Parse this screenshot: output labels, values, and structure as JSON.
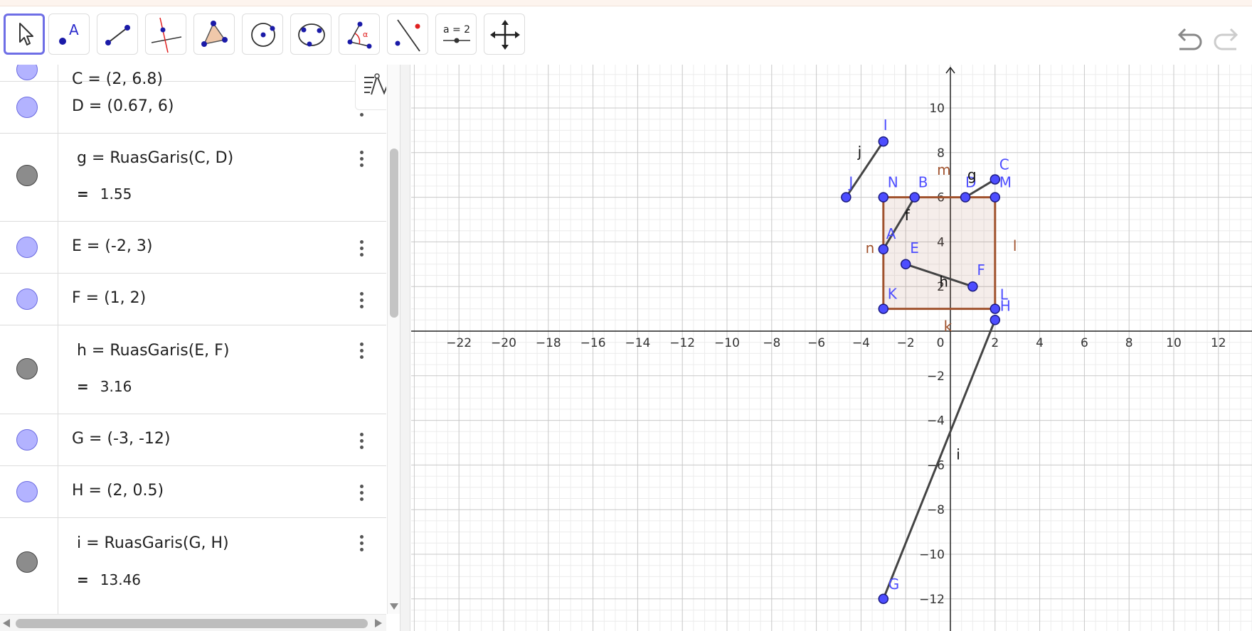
{
  "toolbar": {
    "tools": [
      {
        "name": "move-tool",
        "icon": "cursor-icon",
        "active": true
      },
      {
        "name": "point-tool",
        "icon": "point-icon",
        "label": "A"
      },
      {
        "name": "segment-tool",
        "icon": "segment-icon"
      },
      {
        "name": "perpendicular-line-tool",
        "icon": "perpendicular-icon"
      },
      {
        "name": "polygon-tool",
        "icon": "polygon-icon"
      },
      {
        "name": "circle-center-point-tool",
        "icon": "circle-center-icon"
      },
      {
        "name": "circle-three-points-tool",
        "icon": "circle-three-points-icon"
      },
      {
        "name": "angle-tool",
        "icon": "angle-icon",
        "label": "α"
      },
      {
        "name": "reflect-tool",
        "icon": "reflect-icon"
      },
      {
        "name": "slider-tool",
        "icon": "slider-icon",
        "label": "a = 2"
      },
      {
        "name": "move-graphics-view-tool",
        "icon": "move-arrows-icon"
      }
    ],
    "undo_icon": "undo-icon",
    "redo_icon": "redo-icon"
  },
  "algebra": {
    "partial_top": "C = (2, 6.8)",
    "rows": [
      {
        "kind": "point",
        "definition": "D = (0.67, 6)"
      },
      {
        "kind": "segment",
        "definition": "g = RuasGaris(C, D)",
        "eq": "=",
        "value": "1.55"
      },
      {
        "kind": "point",
        "definition": "E = (-2, 3)"
      },
      {
        "kind": "point",
        "definition": "F = (1, 2)"
      },
      {
        "kind": "segment",
        "definition": "h = RuasGaris(E, F)",
        "eq": "=",
        "value": "3.16"
      },
      {
        "kind": "point",
        "definition": "G = (-3, -12)"
      },
      {
        "kind": "point",
        "definition": "H = (2, 0.5)"
      },
      {
        "kind": "segment",
        "definition": "i = RuasGaris(G, H)",
        "eq": "=",
        "value": "13.46"
      }
    ]
  },
  "graphics": {
    "x_ticks": [
      "-22",
      "-20",
      "-18",
      "-16",
      "-14",
      "-12",
      "-10",
      "-8",
      "-6",
      "-4",
      "-2",
      "0",
      "2",
      "4",
      "6",
      "8",
      "10",
      "12"
    ],
    "y_ticks": [
      "10",
      "8",
      "6",
      "4",
      "2",
      "-2",
      "-4",
      "-6",
      "-8",
      "-10",
      "-12"
    ],
    "colors": {
      "point": "#4d4dff",
      "polygon": "#a0522d",
      "segment": "#444444",
      "grid_major": "#c8c8c8",
      "grid_minor": "#ececec"
    },
    "points": [
      {
        "name": "I",
        "x": -3,
        "y": 8.5
      },
      {
        "name": "J",
        "x": -4.67,
        "y": 6
      },
      {
        "name": "N",
        "x": -3,
        "y": 6
      },
      {
        "name": "B",
        "x": -1.6,
        "y": 6
      },
      {
        "name": "A",
        "x": -3,
        "y": 3.67
      },
      {
        "name": "C",
        "x": 2,
        "y": 6.8
      },
      {
        "name": "D",
        "x": 0.67,
        "y": 6
      },
      {
        "name": "M",
        "x": 2,
        "y": 6
      },
      {
        "name": "E",
        "x": -2,
        "y": 3
      },
      {
        "name": "F",
        "x": 1,
        "y": 2
      },
      {
        "name": "K",
        "x": -3,
        "y": 1
      },
      {
        "name": "L",
        "x": 2,
        "y": 1
      },
      {
        "name": "H",
        "x": 2,
        "y": 0.5
      },
      {
        "name": "G",
        "x": -3,
        "y": -12
      }
    ],
    "segments": [
      {
        "name": "j",
        "from": "J",
        "to": "I"
      },
      {
        "name": "f",
        "from": "A",
        "to": "B"
      },
      {
        "name": "g",
        "from": "D",
        "to": "C"
      },
      {
        "name": "h",
        "from": "E",
        "to": "F"
      },
      {
        "name": "i",
        "from": "G",
        "to": "H"
      }
    ],
    "polygon": {
      "vertices": [
        "K",
        "L",
        "M",
        "N"
      ],
      "edge_labels": [
        "m",
        "n",
        "k",
        "l"
      ]
    }
  }
}
